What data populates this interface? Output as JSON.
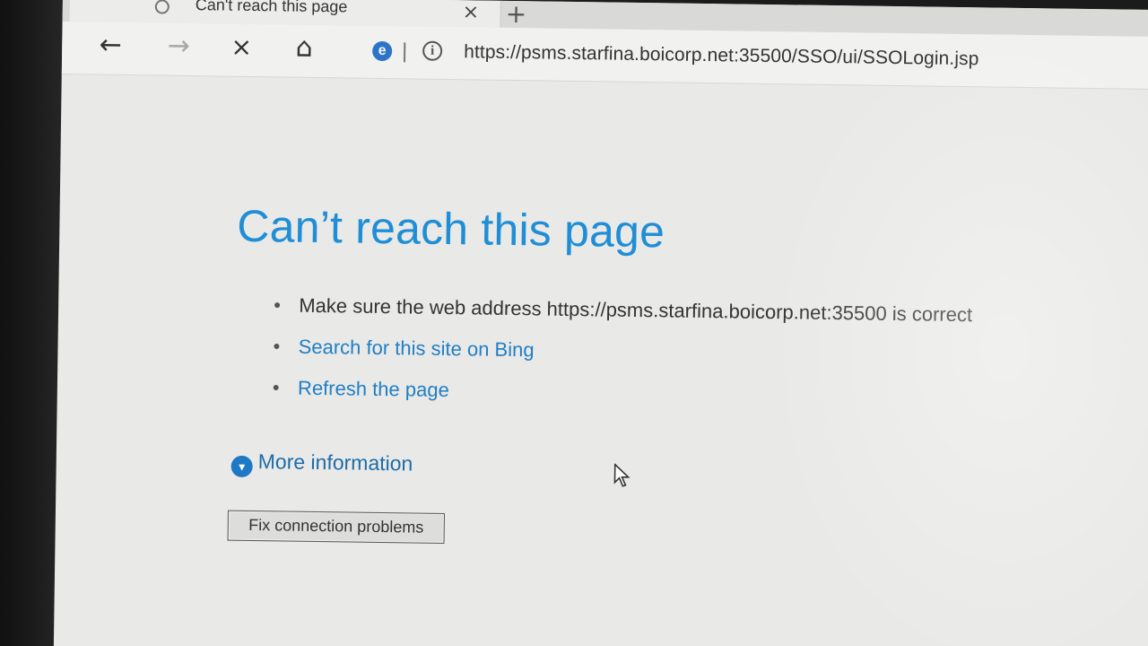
{
  "browser": {
    "tab_title": "Can't reach this page",
    "tab_close": "×",
    "new_tab": "+",
    "back_icon": "←",
    "forward_icon": "→",
    "stop_icon": "×",
    "home_icon": "⌂",
    "browser_logo": "e",
    "info_icon": "i",
    "url": "https://psms.starfina.boicorp.net:35500/SSO/ui/SSOLogin.jsp"
  },
  "page": {
    "heading": "Can’t reach this page",
    "bullets": [
      {
        "text": "Make sure the web address https://psms.starfina.boicorp.net:35500 is correct"
      },
      {
        "text": "Search for this site on Bing"
      },
      {
        "text": "Refresh the page"
      }
    ],
    "more_information": "More information",
    "fix_button": "Fix connection problems"
  }
}
